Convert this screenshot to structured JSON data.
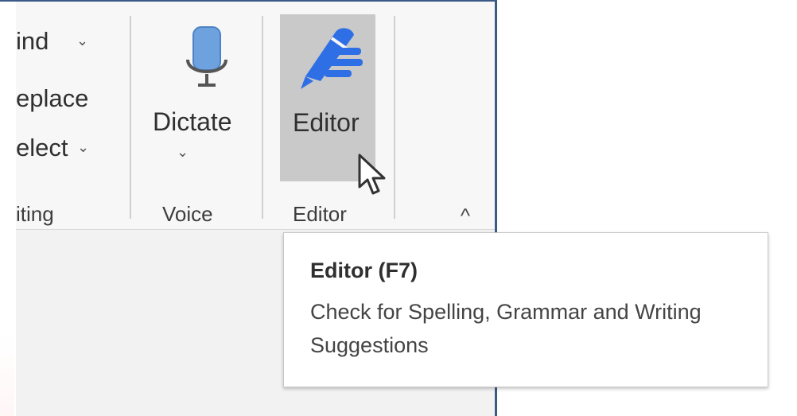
{
  "ribbon": {
    "editing": {
      "find_label": "ind",
      "replace_label": "eplace",
      "select_label": "elect",
      "group_label": "iting"
    },
    "voice": {
      "button_label": "Dictate",
      "group_label": "Voice"
    },
    "editor": {
      "button_label": "Editor",
      "group_label": "Editor"
    }
  },
  "tooltip": {
    "title": "Editor (F7)",
    "description": "Check for Spelling, Grammar and Writing Suggestions"
  },
  "icons": {
    "find_chevron": "chevron-down-icon",
    "select_chevron": "chevron-down-icon",
    "dictate_icon": "microphone-icon",
    "dictate_chevron": "chevron-down-icon",
    "editor_icon": "editor-pen-icon",
    "collapse_icon": "chevron-up-icon",
    "cursor": "mouse-pointer-icon"
  },
  "colors": {
    "ribbon_background": "#f7f7f7",
    "selected_button": "#c9c9c9",
    "accent_blue": "#2e6ce6",
    "microphone_blue": "#6ea2df",
    "window_border": "#3a5b86"
  }
}
